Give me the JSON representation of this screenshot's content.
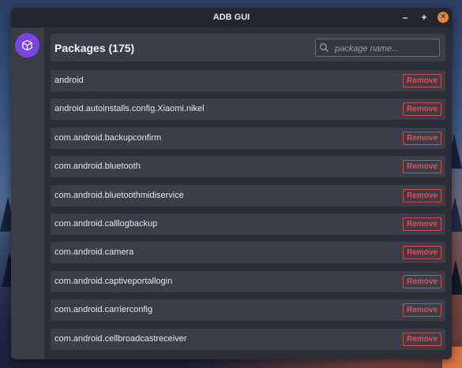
{
  "window": {
    "title": "ADB GUI"
  },
  "titlebar": {
    "minimize": "–",
    "maximize": "+",
    "close": "✕"
  },
  "header": {
    "title": "Packages (175)",
    "search_placeholder": "package name..."
  },
  "packages": [
    {
      "name": "android",
      "action": "Remove"
    },
    {
      "name": "android.autoinstalls.config.Xiaomi.nikel",
      "action": "Remove"
    },
    {
      "name": "com.android.backupconfirm",
      "action": "Remove"
    },
    {
      "name": "com.android.bluetooth",
      "action": "Remove"
    },
    {
      "name": "com.android.bluetoothmidiservice",
      "action": "Remove"
    },
    {
      "name": "com.android.calllogbackup",
      "action": "Remove"
    },
    {
      "name": "com.android.camera",
      "action": "Remove"
    },
    {
      "name": "com.android.captiveportallogin",
      "action": "Remove"
    },
    {
      "name": "com.android.carrierconfig",
      "action": "Remove"
    },
    {
      "name": "com.android.cellbroadcastreceiver",
      "action": "Remove"
    }
  ],
  "colors": {
    "accent": "#7b45e3",
    "danger": "#e05252",
    "close": "#e7833c"
  },
  "icons": {
    "sidebar": "package-icon",
    "search": "search-icon"
  }
}
